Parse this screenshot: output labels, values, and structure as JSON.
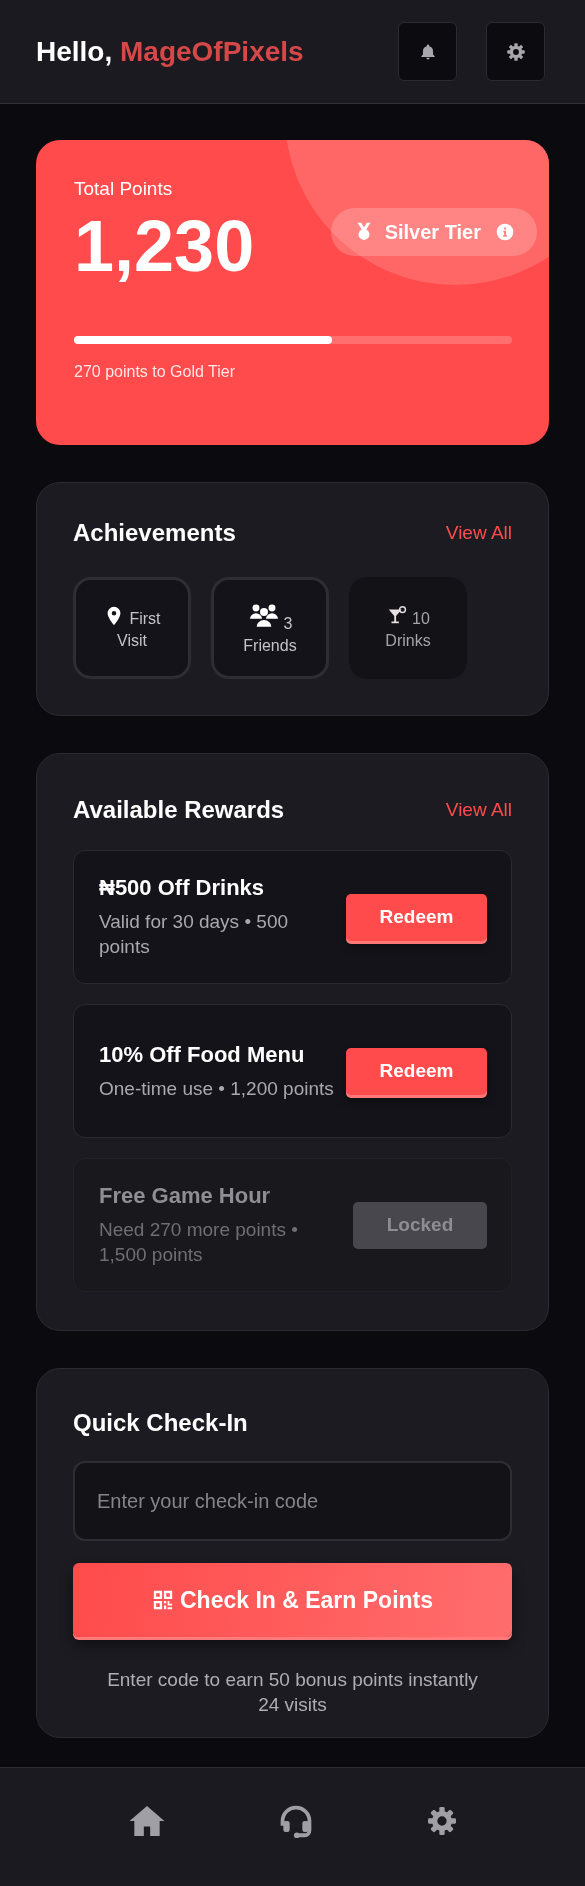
{
  "header": {
    "greeting": "Hello,",
    "username": "MageOfPixels"
  },
  "points": {
    "label": "Total Points",
    "total": "1,230",
    "tier": "Silver Tier",
    "level": 0.59,
    "next_tier_note": "270 points to Gold Tier"
  },
  "achievements": {
    "title": "Achievements",
    "link": "View All",
    "badges": [
      {
        "kind": "pin",
        "label": "First Visit",
        "earned": true
      },
      {
        "kind": "friends",
        "label": "3 Friends",
        "earned": true
      },
      {
        "kind": "drink",
        "label": "10 Drinks",
        "earned": false
      }
    ]
  },
  "rewards": {
    "title": "Available Rewards",
    "link": "View All",
    "items": [
      {
        "title": "₦500 Off Drinks",
        "detail": "Valid for 30 days • 500 points",
        "button": "Redeem",
        "locked": false
      },
      {
        "title": "10% Off Food Menu",
        "detail": "One-time use • 1,200 points",
        "button": "Redeem",
        "locked": false
      },
      {
        "title": "Free Game Hour",
        "detail": "Need 270 more points • 1,500 points",
        "button": "Locked",
        "locked": true
      }
    ]
  },
  "checkin": {
    "title": "Quick Check-In",
    "placeholder": "Enter your check-in code",
    "button": "Check In & Earn Points",
    "note": "Enter code to earn 50 bonus points instantly",
    "visits": "24 visits"
  },
  "nav": [
    {
      "kind": "home"
    },
    {
      "kind": "support"
    },
    {
      "kind": "settings"
    }
  ]
}
